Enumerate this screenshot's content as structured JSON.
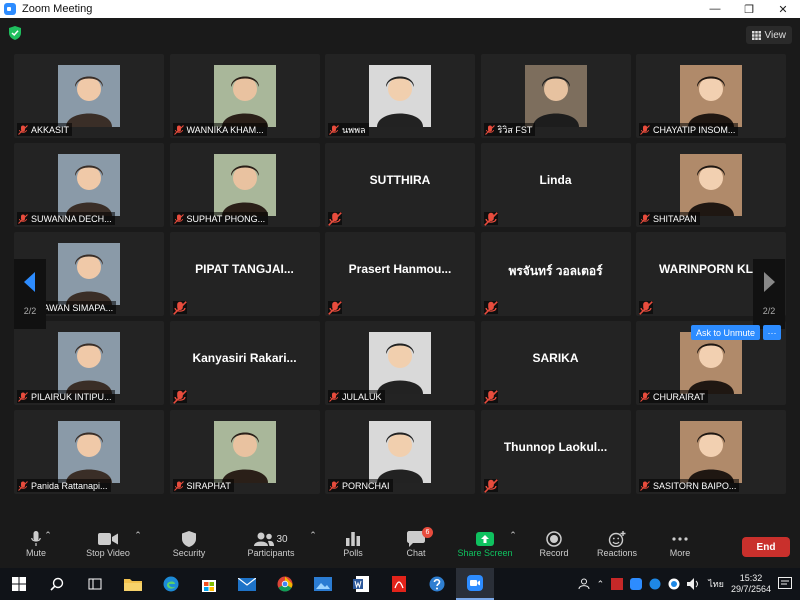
{
  "window": {
    "title": "Zoom Meeting",
    "minimize": "—",
    "maximize": "❐",
    "close": "✕"
  },
  "top": {
    "view_label": "View"
  },
  "pagination": {
    "left": "2/2",
    "right": "2/2"
  },
  "ask_unmute": {
    "label": "Ask to Unmute",
    "more": "···"
  },
  "participants": [
    {
      "name": "AKKASIT",
      "video": true,
      "photo": "man-standing-outdoors"
    },
    {
      "name": "WANNIKA KHAM...",
      "video": true,
      "photo": "woman-sitting-outdoors"
    },
    {
      "name": "นพพล",
      "video": true,
      "photo": "man-smiling-suit"
    },
    {
      "name": "ริวิส FST",
      "video": true,
      "photo": "man-glasses-suit"
    },
    {
      "name": "CHAYATIP INSOM...",
      "video": true,
      "photo": "woman-glasses-bookshelf"
    },
    {
      "name": "SUWANNA DECH...",
      "video": true,
      "photo": "woman-smiling"
    },
    {
      "name": "SUPHAT PHONG...",
      "video": true,
      "photo": "man-glasses-suit"
    },
    {
      "name": "SUTTHIRA",
      "video": false
    },
    {
      "name": "Linda",
      "video": false
    },
    {
      "name": "SHITAPAN",
      "video": true,
      "photo": "woman-formal-portrait"
    },
    {
      "name": "PHAWAN SIMAPA...",
      "video": true,
      "photo": "woman-glasses-painting"
    },
    {
      "name": "PIPAT TANGJAI...",
      "video": false
    },
    {
      "name": "Prasert  Hanmou...",
      "video": false
    },
    {
      "name": "พรจันทร์ วอลเตอร์",
      "video": false
    },
    {
      "name": "WARINPORN  KL...",
      "video": false
    },
    {
      "name": "PILAIRUK INTIPU...",
      "video": true,
      "photo": "woman-short-hair"
    },
    {
      "name": "Kanyasiri  Rakari...",
      "video": false
    },
    {
      "name": "JULALUK",
      "video": true,
      "photo": "woman-pink-dress"
    },
    {
      "name": "SARIKA",
      "video": false
    },
    {
      "name": "CHURAIRAT",
      "video": true,
      "photo": "woman-outdoors"
    },
    {
      "name": "Panida Rattanapi...",
      "video": true,
      "photo": "woman-glasses"
    },
    {
      "name": "SIRAPHAT",
      "video": true,
      "photo": "graduate-red-gown"
    },
    {
      "name": "PORNCHAI",
      "video": true,
      "photo": "man-glasses-suit"
    },
    {
      "name": "Thunnop  Laokul...",
      "video": false
    },
    {
      "name": "SASITORN BAIPO...",
      "video": true,
      "photo": "woman-formal-portrait"
    }
  ],
  "toolbar": {
    "mute": "Mute",
    "stop_video": "Stop Video",
    "security": "Security",
    "participants": "Participants",
    "participants_count": "30",
    "polls": "Polls",
    "chat": "Chat",
    "chat_badge": "6",
    "share_screen": "Share Screen",
    "record": "Record",
    "reactions": "Reactions",
    "more": "More",
    "end": "End"
  },
  "taskbar": {
    "language": "ไทย",
    "time": "15:32",
    "date": "29/7/2564"
  },
  "colors": {
    "accent": "#2d8cff",
    "end": "#c9302c",
    "share": "#0fc15f",
    "muted": "#e84c3d"
  }
}
